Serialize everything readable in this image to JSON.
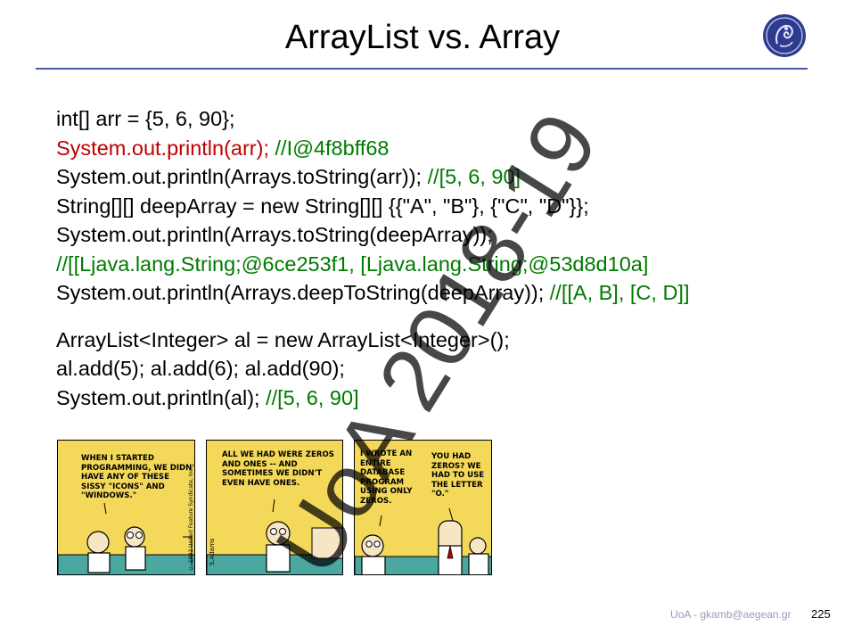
{
  "slide": {
    "title": "ArrayList vs. Array",
    "footer": "UoA - gkamb@aegean.gr",
    "page_number": "225",
    "watermark": "UoA 2018-19"
  },
  "code": {
    "l1": "int[] arr = {5, 6, 90};",
    "l2_code": "System.out.println(arr);",
    "l2_comment": " //I@4f8bff68",
    "l3_code": "System.out.println(Arrays.toString(arr));",
    "l3_comment": " //[5, 6, 90]",
    "l4": "String[][] deepArray = new String[][] {{\"A\", \"B\"}, {\"C\", \"D\"}};",
    "l5": "System.out.println(Arrays.toString(deepArray));",
    "l6_comment": "//[[Ljava.lang.String;@6ce253f1, [Ljava.lang.String;@53d8d10a]",
    "l7_code": "System.out.println(Arrays.deepToString(deepArray));",
    "l7_comment": " //[[A, B], [C, D]]",
    "l8": "ArrayList<Integer> al = new ArrayList<Integer>();",
    "l9": "al.add(5); al.add(6); al.add(90);",
    "l10_code": "System.out.println(al);",
    "l10_comment": " //[5, 6, 90]"
  },
  "comic": {
    "panel1": "WHEN I STARTED\nPROGRAMMING, WE DIDN'T\nHAVE ANY OF THESE\nSISSY \"ICONS\" AND\n\"WINDOWS.\"",
    "panel2": "ALL WE HAD WERE ZEROS\nAND ONES -- AND\nSOMETIMES WE DIDN'T\nEVEN HAVE ONES.",
    "panel3a": "I WROTE AN\nENTIRE\nDATABASE\nPROGRAM\nUSING ONLY\nZEROS.",
    "panel3b": "YOU HAD\nZEROS? WE\nHAD TO USE\nTHE LETTER\n\"O.\"",
    "credit": "S.Adams",
    "copyright": "© 1992 United Feature Syndicate, Inc."
  },
  "colors": {
    "code_red": "#c00000",
    "comment_green": "#007a00",
    "rule_blue": "#4a5aa8",
    "comic_yellow": "#f4d85a"
  }
}
